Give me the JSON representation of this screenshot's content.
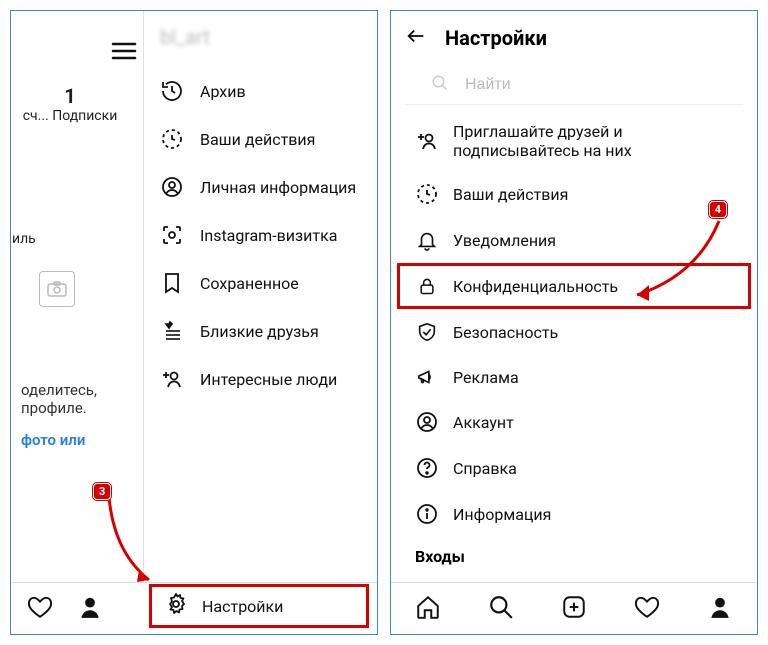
{
  "leftPhone": {
    "username_blur": "bl_art",
    "stat_value": "1",
    "stat_label": "Подписки",
    "stat_prefix": "сч...",
    "tab_cut": "иль",
    "share_line1": "оделитесь,",
    "share_line2": "профиле.",
    "share_link": "фото или",
    "menu": [
      {
        "icon": "history-icon",
        "label": "Архив"
      },
      {
        "icon": "activity-icon",
        "label": "Ваши действия"
      },
      {
        "icon": "person-circle-icon",
        "label": "Личная информация"
      },
      {
        "icon": "qr-icon",
        "label": "Instagram-визитка"
      },
      {
        "icon": "bookmark-icon",
        "label": "Сохраненное"
      },
      {
        "icon": "close-friends-icon",
        "label": "Близкие друзья"
      },
      {
        "icon": "add-person-icon",
        "label": "Интересные люди"
      }
    ],
    "settings_label": "Настройки"
  },
  "rightPhone": {
    "title": "Настройки",
    "search_placeholder": "Найти",
    "rows": [
      {
        "icon": "add-person-icon",
        "label_line1": "Приглашайте друзей и",
        "label_line2": "подписывайтесь на них"
      },
      {
        "icon": "activity-icon",
        "label": "Ваши действия"
      },
      {
        "icon": "bell-icon",
        "label": "Уведомления"
      },
      {
        "icon": "lock-icon",
        "label": "Конфиденциальность",
        "highlight": true
      },
      {
        "icon": "shield-icon",
        "label": "Безопасность"
      },
      {
        "icon": "megaphone-icon",
        "label": "Реклама"
      },
      {
        "icon": "account-icon",
        "label": "Аккаунт"
      },
      {
        "icon": "help-icon",
        "label": "Справка"
      },
      {
        "icon": "info-icon",
        "label": "Информация"
      }
    ],
    "section_label": "Входы"
  },
  "badges": {
    "step3": "3",
    "step4": "4"
  }
}
